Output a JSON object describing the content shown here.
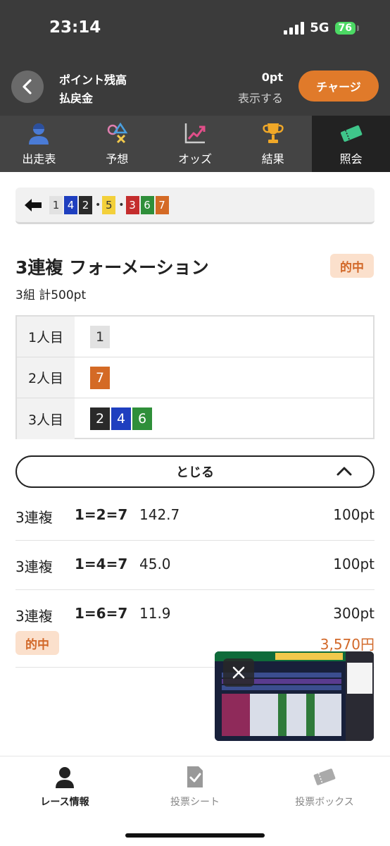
{
  "status": {
    "time": "23:14",
    "network": "5G",
    "battery": "76"
  },
  "header": {
    "line1": "ポイント残高",
    "line2": "払戻金",
    "points": "0pt",
    "show": "表示する",
    "charge": "チャージ"
  },
  "tabs": [
    {
      "label": "出走表",
      "icon": "racer-icon"
    },
    {
      "label": "予想",
      "icon": "symbols-icon"
    },
    {
      "label": "オッズ",
      "icon": "trend-chart-icon"
    },
    {
      "label": "結果",
      "icon": "trophy-icon"
    },
    {
      "label": "照会",
      "icon": "ticket-icon",
      "active": true
    }
  ],
  "combination": [
    {
      "n": "1",
      "color": "#e2e2e2",
      "text": "#333"
    },
    {
      "n": "4",
      "color": "#1f3fbf",
      "text": "#fff"
    },
    {
      "n": "2",
      "color": "#2a2a2a",
      "text": "#fff",
      "dot_after": true
    },
    {
      "n": "5",
      "color": "#f3d03a",
      "text": "#333",
      "dot_after": true
    },
    {
      "n": "3",
      "color": "#c42d2d",
      "text": "#fff"
    },
    {
      "n": "6",
      "color": "#2f8f3a",
      "text": "#fff"
    },
    {
      "n": "7",
      "color": "#d46a25",
      "text": "#fff"
    }
  ],
  "bet": {
    "title": "3連複 フォーメーション",
    "hit": "的中",
    "summary": "3組 計500pt"
  },
  "formation": [
    {
      "label": "1人目",
      "nums": [
        {
          "n": "1",
          "color": "#e2e2e2",
          "text": "#333"
        }
      ]
    },
    {
      "label": "2人目",
      "nums": [
        {
          "n": "7",
          "color": "#d46a25",
          "text": "#fff"
        }
      ]
    },
    {
      "label": "3人目",
      "nums": [
        {
          "n": "2",
          "color": "#2a2a2a",
          "text": "#fff"
        },
        {
          "n": "4",
          "color": "#1f3fbf",
          "text": "#fff"
        },
        {
          "n": "6",
          "color": "#2f8f3a",
          "text": "#fff"
        }
      ]
    }
  ],
  "close_label": "とじる",
  "lines": [
    {
      "kind": "3連複",
      "combo": "1=2=7",
      "odds": "142.7",
      "amount": "100pt"
    },
    {
      "kind": "3連複",
      "combo": "1=4=7",
      "odds": "45.0",
      "amount": "100pt"
    },
    {
      "kind": "3連複",
      "combo": "1=6=7",
      "odds": "11.9",
      "amount": "300pt"
    }
  ],
  "hit_label": "的中",
  "payout": "3,570円",
  "bottom_tabs": [
    {
      "label": "レース情報",
      "icon": "racer-icon"
    },
    {
      "label": "投票シート",
      "icon": "check-sheet-icon"
    },
    {
      "label": "投票ボックス",
      "icon": "ticket-box-icon"
    }
  ]
}
